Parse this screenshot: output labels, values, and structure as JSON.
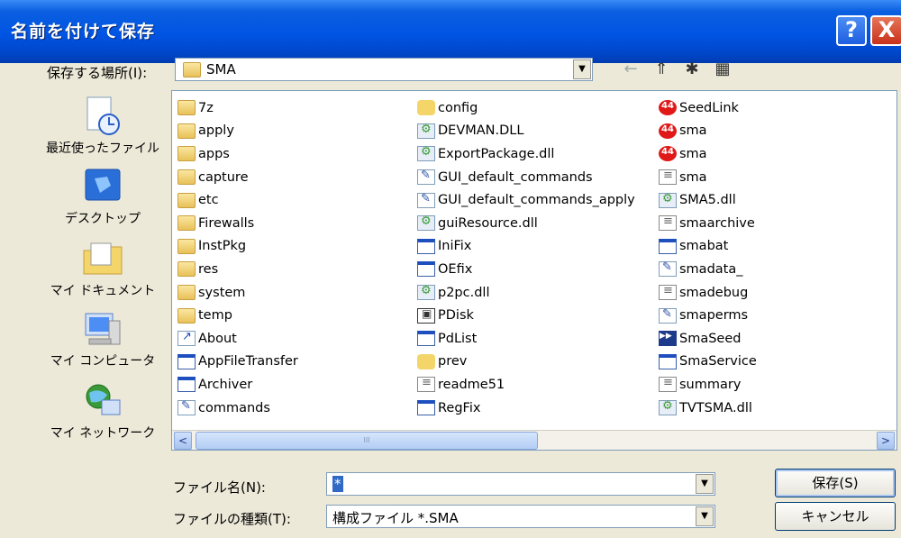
{
  "window": {
    "title": "名前を付けて保存",
    "help": "?",
    "close": "X"
  },
  "save_in": {
    "label": "保存する場所(I):",
    "value": "SMA"
  },
  "places": [
    {
      "label": "最近使ったファイル",
      "icon": "recent-icon"
    },
    {
      "label": "デスクトップ",
      "icon": "desktop-icon"
    },
    {
      "label": "マイ ドキュメント",
      "icon": "my-documents-icon"
    },
    {
      "label": "マイ コンピュータ",
      "icon": "my-computer-icon"
    },
    {
      "label": "マイ ネットワーク",
      "icon": "my-network-icon"
    }
  ],
  "files": {
    "col1": [
      {
        "name": "7z",
        "type": "folder"
      },
      {
        "name": "apply",
        "type": "folder"
      },
      {
        "name": "apps",
        "type": "folder"
      },
      {
        "name": "capture",
        "type": "folder"
      },
      {
        "name": "etc",
        "type": "folder"
      },
      {
        "name": "Firewalls",
        "type": "folder"
      },
      {
        "name": "InstPkg",
        "type": "folder"
      },
      {
        "name": "res",
        "type": "folder"
      },
      {
        "name": "system",
        "type": "folder"
      },
      {
        "name": "temp",
        "type": "folder"
      },
      {
        "name": "About",
        "type": "shortcut"
      },
      {
        "name": "AppFileTransfer",
        "type": "window"
      },
      {
        "name": "Archiver",
        "type": "window"
      },
      {
        "name": "commands",
        "type": "config"
      }
    ],
    "col2": [
      {
        "name": "config",
        "type": "gear"
      },
      {
        "name": "DEVMAN.DLL",
        "type": "dll"
      },
      {
        "name": "ExportPackage.dll",
        "type": "dll"
      },
      {
        "name": "GUI_default_commands",
        "type": "config"
      },
      {
        "name": "GUI_default_commands_apply",
        "type": "config"
      },
      {
        "name": "guiResource.dll",
        "type": "dll"
      },
      {
        "name": "IniFix",
        "type": "window"
      },
      {
        "name": "OEfix",
        "type": "window"
      },
      {
        "name": "p2pc.dll",
        "type": "dll"
      },
      {
        "name": "PDisk",
        "type": "pdisk"
      },
      {
        "name": "PdList",
        "type": "window"
      },
      {
        "name": "prev",
        "type": "gear"
      },
      {
        "name": "readme51",
        "type": "text"
      },
      {
        "name": "RegFix",
        "type": "window"
      }
    ],
    "col3": [
      {
        "name": "SeedLink",
        "type": "red"
      },
      {
        "name": "sma",
        "type": "red"
      },
      {
        "name": "sma",
        "type": "red"
      },
      {
        "name": "sma",
        "type": "text"
      },
      {
        "name": "SMA5.dll",
        "type": "dll"
      },
      {
        "name": "smaarchive",
        "type": "text"
      },
      {
        "name": "smabat",
        "type": "window"
      },
      {
        "name": "smadata_",
        "type": "config"
      },
      {
        "name": "smadebug",
        "type": "text"
      },
      {
        "name": "smaperms",
        "type": "config"
      },
      {
        "name": "SmaSeed",
        "type": "seed"
      },
      {
        "name": "SmaService",
        "type": "window"
      },
      {
        "name": "summary",
        "type": "text"
      },
      {
        "name": "TVTSMA.dll",
        "type": "dll"
      }
    ]
  },
  "filename": {
    "label": "ファイル名(N):",
    "value": "*"
  },
  "filetype": {
    "label": "ファイルの種類(T):",
    "value": "構成ファイル *.SMA"
  },
  "buttons": {
    "save": "保存(S)",
    "cancel": "キャンセル"
  },
  "scrollbar": {
    "left": "<",
    "right": ">",
    "thumb": "III"
  }
}
